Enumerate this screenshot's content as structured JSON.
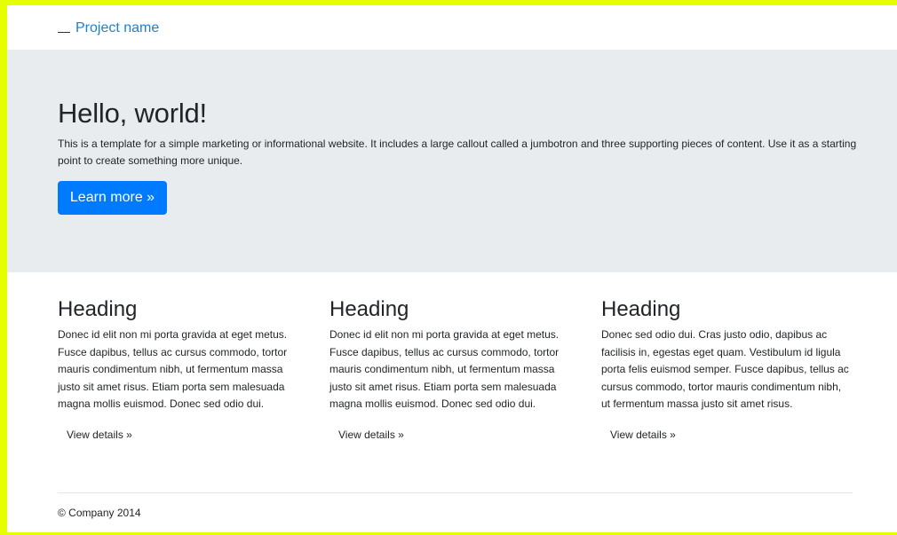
{
  "navbar": {
    "brand": "Project name",
    "toggle_icon": "menu-bar-icon"
  },
  "jumbotron": {
    "title": "Hello, world!",
    "text": "This is a template for a simple marketing or informational website. It includes a large callout called a jumbotron and three supporting pieces of content. Use it as a starting point to create something more unique.",
    "button_label": "Learn more »"
  },
  "columns": [
    {
      "heading": "Heading",
      "body": "Donec id elit non mi porta gravida at eget metus. Fusce dapibus, tellus ac cursus commodo, tortor mauris condimentum nibh, ut fermentum massa justo sit amet risus. Etiam porta sem malesuada magna mollis euismod. Donec sed odio dui.",
      "button_label": "View details »"
    },
    {
      "heading": "Heading",
      "body": "Donec id elit non mi porta gravida at eget metus. Fusce dapibus, tellus ac cursus commodo, tortor mauris condimentum nibh, ut fermentum massa justo sit amet risus. Etiam porta sem malesuada magna mollis euismod. Donec sed odio dui.",
      "button_label": "View details »"
    },
    {
      "heading": "Heading",
      "body": "Donec sed odio dui. Cras justo odio, dapibus ac facilisis in, egestas eget quam. Vestibulum id ligula porta felis euismod semper. Fusce dapibus, tellus ac cursus commodo, tortor mauris condimentum nibh, ut fermentum massa justo sit amet risus.",
      "button_label": "View details »"
    }
  ],
  "footer": {
    "text": "© Company 2014"
  },
  "colors": {
    "frame": "#e6ff00",
    "jumbotron_bg": "#e9ecef",
    "primary": "#007bff",
    "brand_link": "#1f7fd0"
  }
}
